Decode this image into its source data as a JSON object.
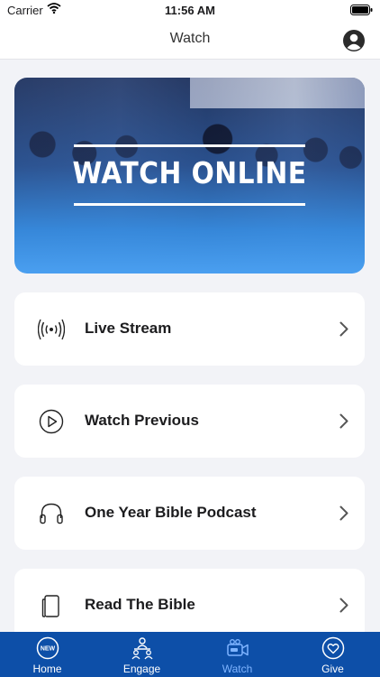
{
  "status_bar": {
    "carrier": "Carrier",
    "time": "11:56 AM"
  },
  "nav": {
    "title": "Watch",
    "profile_icon": "person-circle-icon"
  },
  "hero": {
    "text": "WATCH ONLINE"
  },
  "menu": {
    "items": [
      {
        "label": "Live Stream",
        "icon": "broadcast-icon"
      },
      {
        "label": "Watch Previous",
        "icon": "play-circle-icon"
      },
      {
        "label": "One Year Bible Podcast",
        "icon": "headphones-icon"
      },
      {
        "label": "Read The Bible",
        "icon": "book-icon"
      }
    ]
  },
  "tab_bar": {
    "background": "#0d4fa8",
    "active_color": "#7fb4ff",
    "tabs": [
      {
        "label": "Home",
        "icon": "new-badge-icon"
      },
      {
        "label": "Engage",
        "icon": "people-group-icon"
      },
      {
        "label": "Watch",
        "icon": "video-camera-icon",
        "active": true
      },
      {
        "label": "Give",
        "icon": "heart-circle-icon"
      }
    ]
  }
}
